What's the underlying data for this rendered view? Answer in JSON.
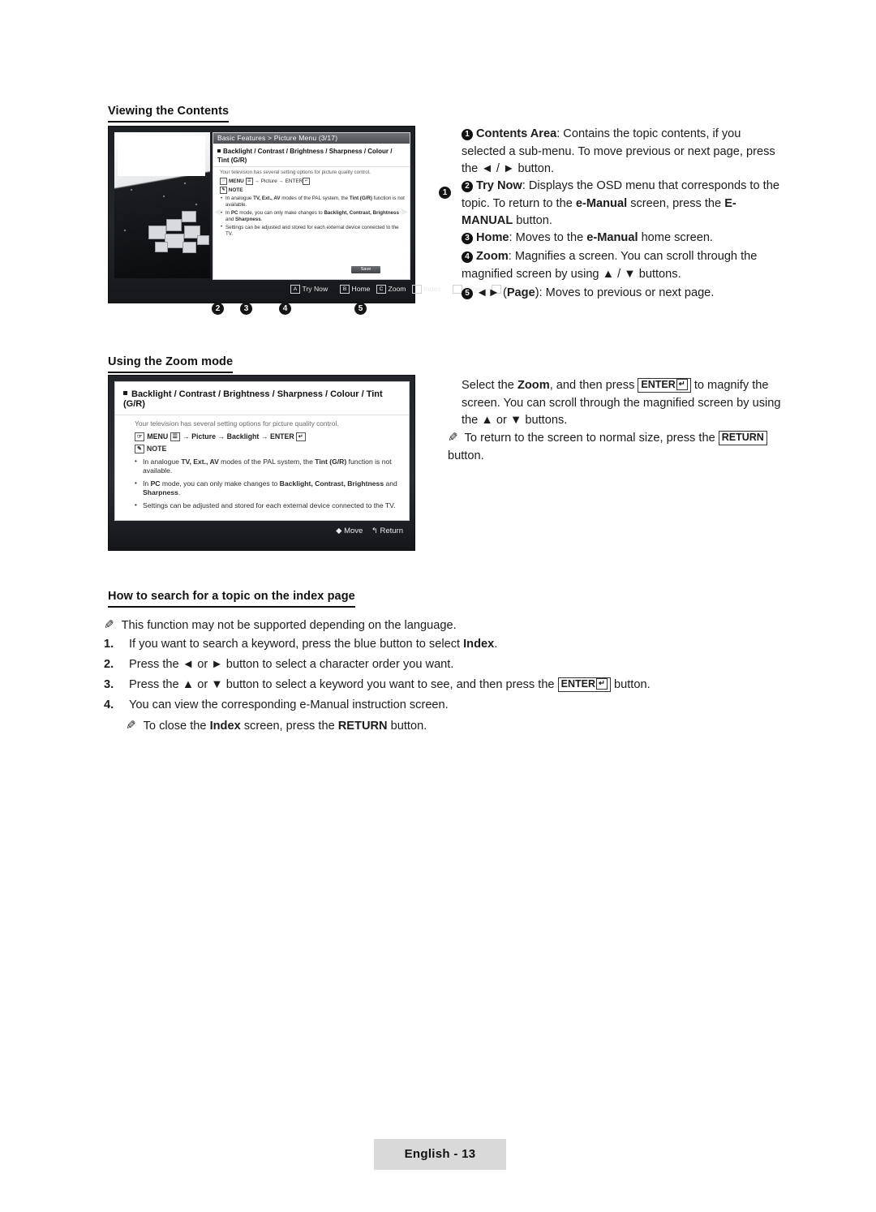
{
  "headings": {
    "viewing_contents": "Viewing the Contents",
    "using_zoom": "Using the Zoom mode",
    "how_to_search": "How to search for a topic on the index page"
  },
  "right_column": {
    "item1_label": "Contents Area",
    "item1_text": ": Contains the topic contents, if you selected a sub-menu. To move previous or next page, press the ◄ / ► button.",
    "item2_label": "Try Now",
    "item2_text_a": ": Displays the OSD menu that corresponds to the topic. To return to the ",
    "item2_emanual": "e-Manual",
    "item2_text_b": " screen, press the ",
    "item2_emanual_btn": "E-MANUAL",
    "item2_text_c": " button.",
    "item3_label": "Home",
    "item3_text_a": ": Moves to the ",
    "item3_emanual": "e-Manual",
    "item3_text_b": " home screen.",
    "item4_label": "Zoom",
    "item4_text": ": Magnifies a screen. You can scroll through the magnified screen by using ▲ / ▼ buttons.",
    "item5_label": "Page",
    "item5_text": ": Moves to previous or next page.",
    "item5_prefix": "◄► (",
    "item5_suffix": ")"
  },
  "zoom_column": {
    "p1_a": "Select the ",
    "p1_zoom": "Zoom",
    "p1_b": ", and then press ",
    "p1_enter": "ENTER",
    "p1_c": " to magnify the screen. You can scroll through the magnified screen by using the ▲ or ▼ buttons.",
    "p2_a": "To return to the screen to normal size, press the ",
    "p2_return": "RETURN",
    "p2_b": " button."
  },
  "tv_figure": {
    "title_bar": "Basic Features > Picture Menu (3/17)",
    "topic": "Backlight / Contrast / Brightness / Sharpness / Colour / Tint (G/R)",
    "lead": "Your television has several setting options for picture quality control.",
    "menu_path_keys": "MENU",
    "menu_path": "→ Picture → ENTER",
    "note": "NOTE",
    "bullet1_a": "In analogue ",
    "bullet1_tv": "TV, Ext., AV",
    "bullet1_b": " modes of the PAL system, the ",
    "bullet1_tint": "Tint (G/R)",
    "bullet1_c": " function is not available.",
    "bullet2_a": "In ",
    "bullet2_pc": "PC",
    "bullet2_b": " mode, you can only make changes to ",
    "bullet2_items": "Backlight, Contrast, Brightness",
    "bullet2_c": " and ",
    "bullet2_items2": "Sharpness",
    "bullet2_d": ".",
    "bullet3": "Settings can be adjusted and stored for each external device connected to the TV.",
    "save_label": "Save",
    "bar": [
      {
        "key": "A",
        "label": "Try Now"
      },
      {
        "key": "B",
        "label": "Home"
      },
      {
        "key": "C",
        "label": "Zoom"
      },
      {
        "key": "D",
        "label": "Index"
      },
      {
        "key": "◄►",
        "label": "Page"
      },
      {
        "key": "↲",
        "label": "Exit"
      }
    ],
    "callouts": [
      "1",
      "2",
      "3",
      "4",
      "5"
    ]
  },
  "zoom_figure": {
    "topic": "Backlight / Contrast / Brightness / Sharpness / Colour / Tint (G/R)",
    "lead": "Your television has several setting options for picture quality control.",
    "menu_keys": "MENU",
    "menu_path": "→ Picture → Backlight → ENTER",
    "note": "NOTE",
    "bullet1_a": "In analogue ",
    "bullet1_tv": "TV, Ext., AV",
    "bullet1_b": " modes of the PAL system, the ",
    "bullet1_tint": "Tint (G/R)",
    "bullet1_c": " function is not available.",
    "bullet2_a": "In ",
    "bullet2_pc": "PC",
    "bullet2_b": " mode, you can only make changes to ",
    "bullet2_items": "Backlight, Contrast, Brightness",
    "bullet2_c": " and ",
    "bullet2_items2": "Sharpness",
    "bullet2_d": ".",
    "bullet3": "Settings can be adjusted and stored for each external device connected to the TV.",
    "footer_move": "Move",
    "footer_return": "Return"
  },
  "search_section": {
    "note": "This function may not be supported depending on the language.",
    "steps": [
      {
        "n": "1.",
        "a": "If you want to search a keyword, press the blue button to select ",
        "bold": "Index",
        "b": "."
      },
      {
        "n": "2.",
        "a": "Press the ◄ or ► button to select a character order you want.",
        "bold": "",
        "b": ""
      },
      {
        "n": "3.",
        "a": "Press the ▲ or ▼ button to select a keyword you want to see, and then press the ",
        "bold": "ENTER",
        "b": " button."
      },
      {
        "n": "4.",
        "a": "You can view the corresponding e-Manual instruction screen.",
        "bold": "",
        "b": ""
      }
    ],
    "closing_a": "To close the ",
    "closing_index": "Index",
    "closing_b": " screen, press the ",
    "closing_return": "RETURN",
    "closing_c": " button."
  },
  "footer": {
    "page_label": "English - 13"
  }
}
